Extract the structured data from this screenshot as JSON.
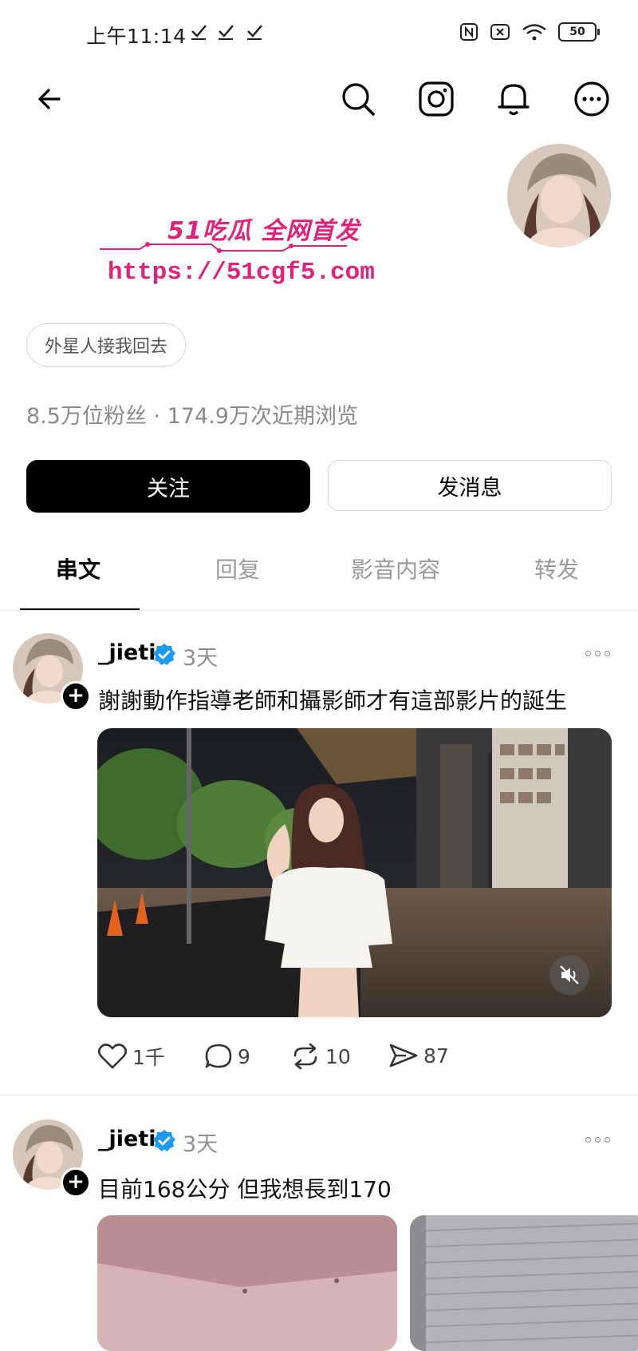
{
  "status_bar": {
    "time": "上午11:14",
    "battery": "50",
    "icons": [
      "check-icon",
      "check-icon",
      "check-icon",
      "nfc-icon",
      "sim-off-icon",
      "wifi-icon",
      "battery-icon"
    ]
  },
  "nav": {
    "icons": [
      "back-arrow-icon",
      "search-icon",
      "instagram-icon",
      "bell-icon",
      "more-circle-icon"
    ]
  },
  "watermark": {
    "line1": "51吃瓜 全网首发",
    "line2": "https://51cgf5.com"
  },
  "profile": {
    "bio_chip": "外星人接我回去",
    "stats": "8.5万位粉丝 · 174.9万次近期浏览",
    "follow_label": "关注",
    "message_label": "发消息"
  },
  "tabs": [
    {
      "label": "串文",
      "active": true
    },
    {
      "label": "回复",
      "active": false
    },
    {
      "label": "影音内容",
      "active": false
    },
    {
      "label": "转发",
      "active": false
    }
  ],
  "posts": [
    {
      "username": "_jieti",
      "verified": true,
      "time": "3天",
      "text": "謝謝動作指導老師和攝影師才有這部影片的誕生",
      "media": "video",
      "actions": {
        "likes": "1千",
        "comments": "9",
        "reposts": "10",
        "shares": "87"
      }
    },
    {
      "username": "_jieti",
      "verified": true,
      "time": "3天",
      "text": "目前168公分 但我想長到170",
      "media": "images"
    }
  ],
  "colors": {
    "accent_black": "#000000",
    "verified_blue": "#1d9bf0",
    "watermark_pink": "#e0227a",
    "muted_text": "#8a8a8a"
  }
}
